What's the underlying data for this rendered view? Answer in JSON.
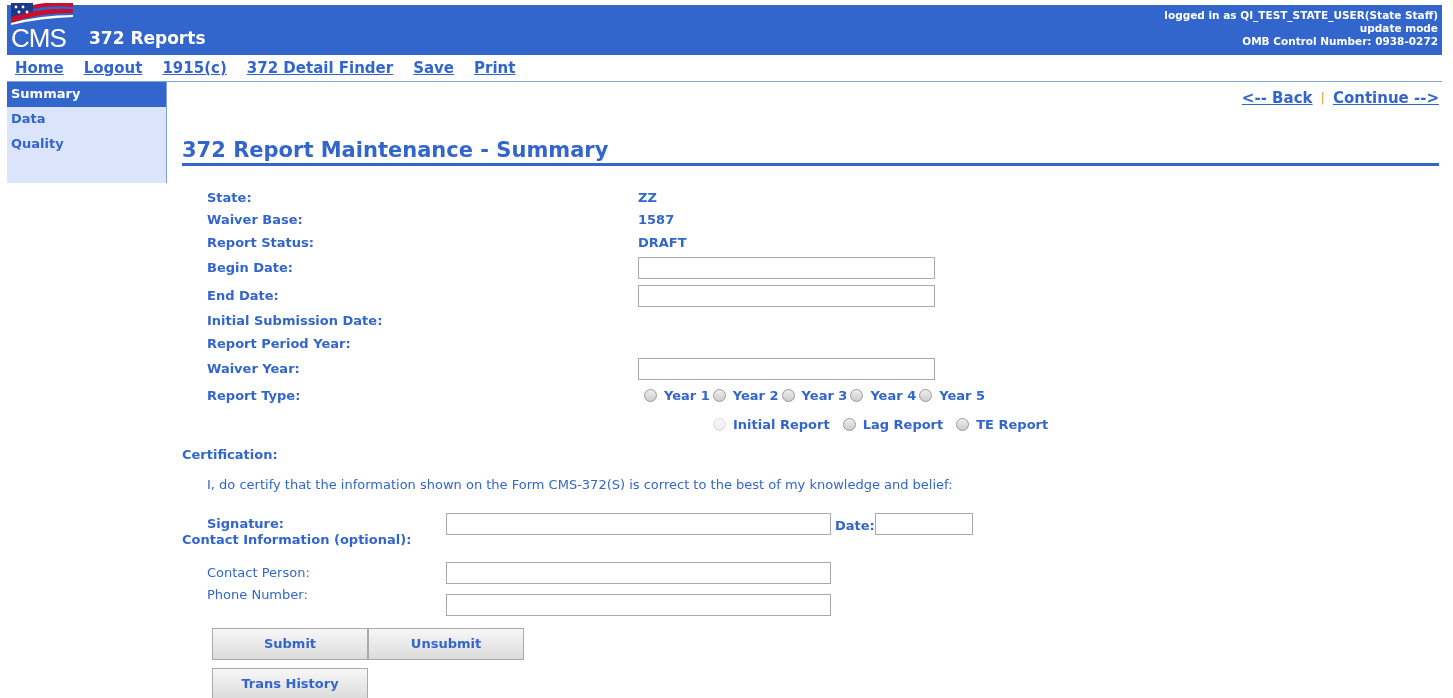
{
  "header": {
    "logo_text": "CMS",
    "title": "372 Reports",
    "user_info": [
      "logged in as QI_TEST_STATE_USER(State Staff)",
      "update mode",
      "OMB Control Number: 0938-0272"
    ]
  },
  "nav_links": [
    "Home",
    "Logout",
    "1915(c)",
    "372 Detail Finder",
    "Save",
    "Print"
  ],
  "sidebar": {
    "items": [
      {
        "label": "Summary",
        "selected": true
      },
      {
        "label": "Data",
        "selected": false
      },
      {
        "label": "Quality",
        "selected": false
      }
    ]
  },
  "pager": {
    "back": "<-- Back",
    "separator": "|",
    "continue": "Continue -->"
  },
  "page_title": "372 Report Maintenance - Summary",
  "summary_fields": [
    {
      "label": "State:",
      "kind": "text",
      "value": "ZZ"
    },
    {
      "label": "Waiver Base:",
      "kind": "text",
      "value": "1587"
    },
    {
      "label": "Report Status:",
      "kind": "text",
      "value": "DRAFT"
    },
    {
      "label": "Begin Date:",
      "kind": "input"
    },
    {
      "label": "End Date:",
      "kind": "input"
    },
    {
      "label": "Initial Submission Date:",
      "kind": "empty"
    },
    {
      "label": "Report Period Year:",
      "kind": "empty"
    },
    {
      "label": "Waiver Year:",
      "kind": "input"
    }
  ],
  "report_type": {
    "label": "Report Type:",
    "year_options": [
      {
        "label": "Year 1",
        "selected": false,
        "disabled": false
      },
      {
        "label": "Year 2",
        "selected": false,
        "disabled": false
      },
      {
        "label": "Year 3",
        "selected": false,
        "disabled": false
      },
      {
        "label": "Year 4",
        "selected": false,
        "disabled": false
      },
      {
        "label": "Year 5",
        "selected": false,
        "disabled": false
      }
    ],
    "type_options": [
      {
        "label": "Initial Report",
        "selected": false,
        "disabled": true
      },
      {
        "label": "Lag Report",
        "selected": false,
        "disabled": false
      },
      {
        "label": "TE Report",
        "selected": false,
        "disabled": false
      }
    ]
  },
  "certification": {
    "heading": "Certification:",
    "statement": "I, do certify that the information shown on the Form CMS-372(S) is correct to the best of my knowledge and belief:",
    "signature_label": "Signature:",
    "date_label": "Date:",
    "contact_heading": "Contact Information (optional):",
    "contact_fields": [
      {
        "label": "Contact Person:"
      },
      {
        "label": "Phone Number:"
      }
    ]
  },
  "button_rows": [
    [
      "Submit",
      "Unsubmit"
    ],
    [
      "Trans History"
    ]
  ]
}
